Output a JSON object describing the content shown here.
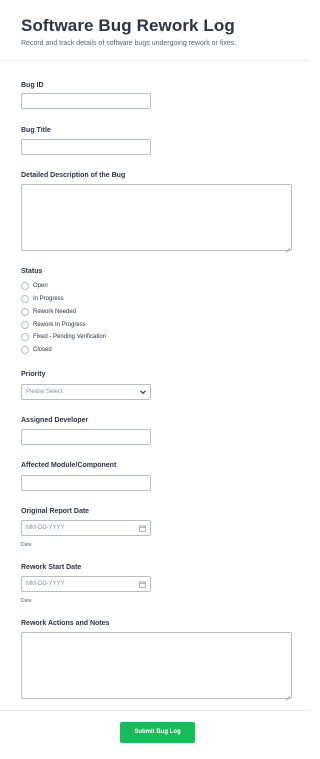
{
  "form": {
    "title": "Software Bug Rework Log",
    "subtitle": "Record and track details of software bugs undergoing rework or fixes."
  },
  "fields": {
    "bug_id": {
      "label": "Bug ID",
      "value": ""
    },
    "bug_title": {
      "label": "Bug Title",
      "value": ""
    },
    "description": {
      "label": "Detailed Description of the Bug",
      "value": ""
    },
    "status": {
      "label": "Status",
      "options": [
        "Open",
        "In Progress",
        "Rework Needed",
        "Rework In Progress",
        "Fixed - Pending Verification",
        "Closed"
      ]
    },
    "priority": {
      "label": "Priority",
      "placeholder": "Please Select"
    },
    "developer": {
      "label": "Assigned Developer",
      "value": ""
    },
    "module": {
      "label": "Affected Module/Component",
      "value": ""
    },
    "report_date": {
      "label": "Original Report Date",
      "placeholder": "MM-DD-YYYY",
      "sublabel": "Date"
    },
    "rework_date": {
      "label": "Rework Start Date",
      "placeholder": "MM-DD-YYYY",
      "sublabel": "Date"
    },
    "notes": {
      "label": "Rework Actions and Notes",
      "value": ""
    }
  },
  "submit": {
    "label": "Submit Bug Log",
    "color": "#18bd5b"
  },
  "icons": {
    "dropdown": "chevron-down-icon",
    "date": "calendar-icon"
  }
}
